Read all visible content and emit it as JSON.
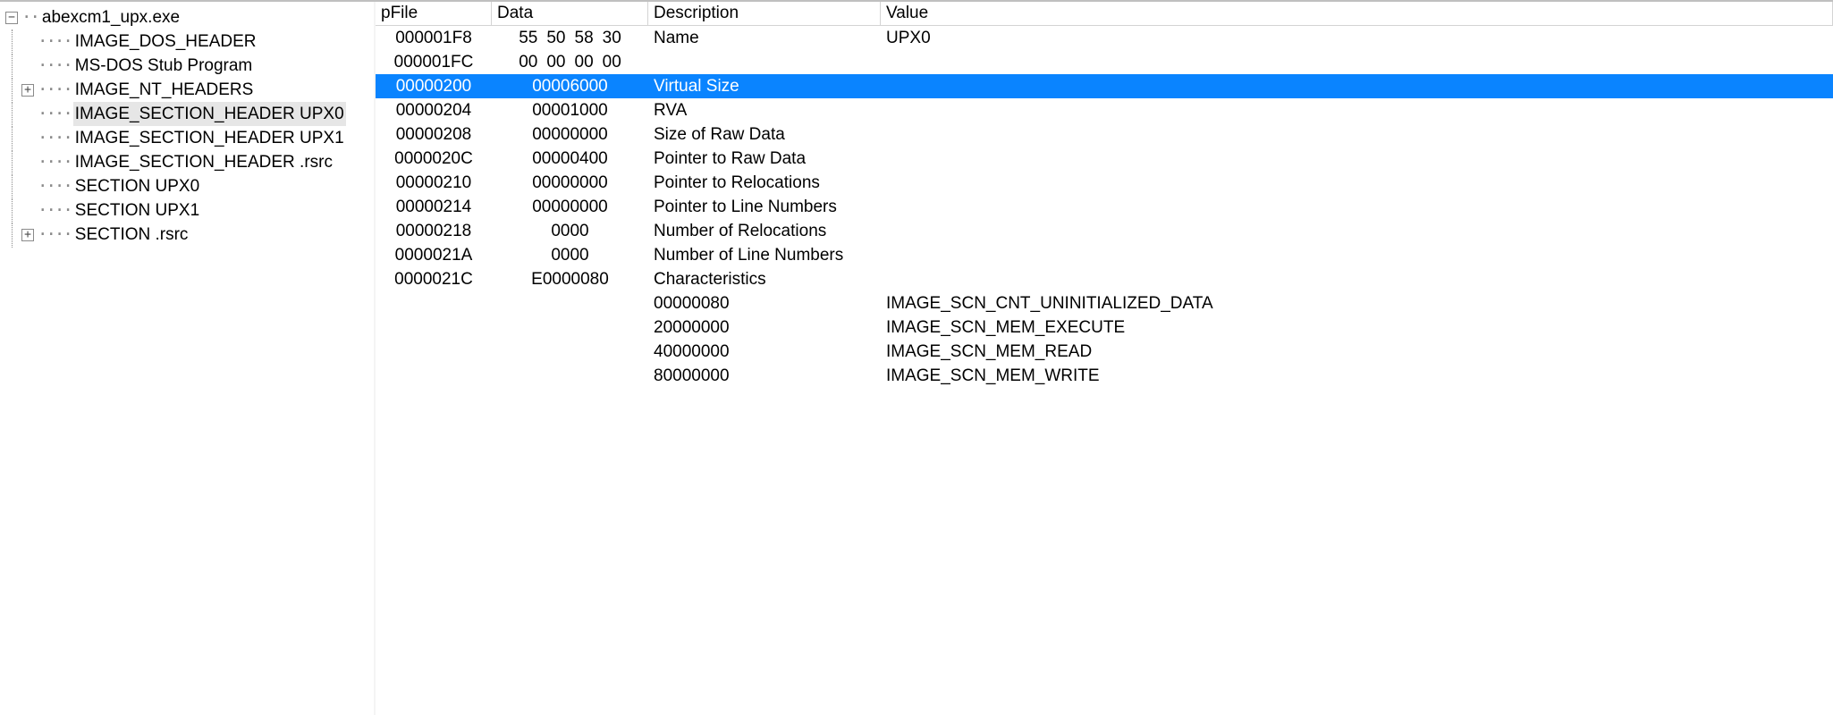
{
  "headers": {
    "pfile": "pFile",
    "data": "Data",
    "description": "Description",
    "value": "Value"
  },
  "tree": {
    "root": {
      "label": "abexcm1_upx.exe",
      "expand": "−"
    },
    "items": [
      {
        "label": "IMAGE_DOS_HEADER",
        "expand": ""
      },
      {
        "label": "MS-DOS Stub Program",
        "expand": ""
      },
      {
        "label": "IMAGE_NT_HEADERS",
        "expand": "+"
      },
      {
        "label": "IMAGE_SECTION_HEADER UPX0",
        "expand": "",
        "selected": true
      },
      {
        "label": "IMAGE_SECTION_HEADER UPX1",
        "expand": ""
      },
      {
        "label": "IMAGE_SECTION_HEADER .rsrc",
        "expand": ""
      },
      {
        "label": "SECTION UPX0",
        "expand": ""
      },
      {
        "label": "SECTION UPX1",
        "expand": ""
      },
      {
        "label": "SECTION .rsrc",
        "expand": "+"
      }
    ]
  },
  "rows": [
    {
      "pfile": "000001F8",
      "data_bytes": [
        "55",
        "50",
        "58",
        "30"
      ],
      "data": "",
      "description": "Name",
      "value": "UPX0"
    },
    {
      "pfile": "000001FC",
      "data_bytes": [
        "00",
        "00",
        "00",
        "00"
      ],
      "data": "",
      "description": "",
      "value": ""
    },
    {
      "pfile": "00000200",
      "data": "00006000",
      "description": "Virtual Size",
      "value": "",
      "selected": true
    },
    {
      "pfile": "00000204",
      "data": "00001000",
      "description": "RVA",
      "value": ""
    },
    {
      "pfile": "00000208",
      "data": "00000000",
      "description": "Size of Raw Data",
      "value": ""
    },
    {
      "pfile": "0000020C",
      "data": "00000400",
      "description": "Pointer to Raw Data",
      "value": ""
    },
    {
      "pfile": "00000210",
      "data": "00000000",
      "description": "Pointer to Relocations",
      "value": ""
    },
    {
      "pfile": "00000214",
      "data": "00000000",
      "description": "Pointer to Line Numbers",
      "value": ""
    },
    {
      "pfile": "00000218",
      "data": "0000",
      "description": "Number of Relocations",
      "value": ""
    },
    {
      "pfile": "0000021A",
      "data": "0000",
      "description": "Number of Line Numbers",
      "value": ""
    },
    {
      "pfile": "0000021C",
      "data": "E0000080",
      "description": "Characteristics",
      "value": ""
    },
    {
      "pfile": "",
      "data": "",
      "description": "00000080",
      "value": "IMAGE_SCN_CNT_UNINITIALIZED_DATA"
    },
    {
      "pfile": "",
      "data": "",
      "description": "20000000",
      "value": "IMAGE_SCN_MEM_EXECUTE"
    },
    {
      "pfile": "",
      "data": "",
      "description": "40000000",
      "value": "IMAGE_SCN_MEM_READ"
    },
    {
      "pfile": "",
      "data": "",
      "description": "80000000",
      "value": "IMAGE_SCN_MEM_WRITE"
    }
  ]
}
